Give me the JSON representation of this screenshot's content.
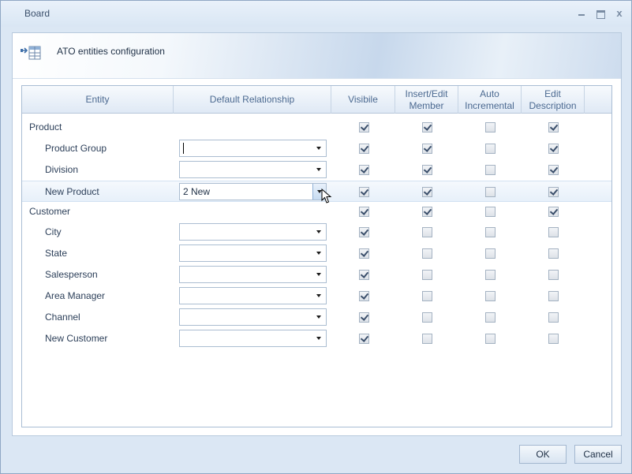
{
  "window": {
    "title": "Board",
    "controls": [
      "minimize-icon",
      "maximize-icon",
      "close-icon"
    ],
    "close_glyph": "x"
  },
  "banner": {
    "title": "ATO entities configuration",
    "icon": "table-link-icon"
  },
  "grid": {
    "columns": {
      "entity": "Entity",
      "default_relationship": "Default Relationship",
      "visible": "Visibile",
      "insert_edit_member": "Insert/Edit\nMember",
      "auto_incremental": "Auto\nIncremental",
      "edit_description": "Edit\nDescription"
    },
    "rows": [
      {
        "label": "Product",
        "level": 0,
        "combo": false,
        "visible": true,
        "insert_edit": true,
        "auto": false,
        "edit_desc": true
      },
      {
        "label": "Product Group",
        "level": 1,
        "combo": true,
        "value": "",
        "focused": true,
        "visible": true,
        "insert_edit": true,
        "auto": false,
        "edit_desc": true
      },
      {
        "label": "Division",
        "level": 1,
        "combo": true,
        "value": "",
        "visible": true,
        "insert_edit": true,
        "auto": false,
        "edit_desc": true
      },
      {
        "label": "New Product",
        "level": 1,
        "combo": true,
        "value": "2 New",
        "hover": true,
        "visible": true,
        "insert_edit": true,
        "auto": false,
        "edit_desc": true
      },
      {
        "label": "Customer",
        "level": 0,
        "combo": false,
        "visible": true,
        "insert_edit": true,
        "auto": false,
        "edit_desc": true
      },
      {
        "label": "City",
        "level": 1,
        "combo": true,
        "value": "",
        "visible": true,
        "insert_edit": false,
        "auto": false,
        "edit_desc": false
      },
      {
        "label": "State",
        "level": 1,
        "combo": true,
        "value": "",
        "visible": true,
        "insert_edit": false,
        "auto": false,
        "edit_desc": false
      },
      {
        "label": "Salesperson",
        "level": 1,
        "combo": true,
        "value": "",
        "visible": true,
        "insert_edit": false,
        "auto": false,
        "edit_desc": false
      },
      {
        "label": "Area Manager",
        "level": 1,
        "combo": true,
        "value": "",
        "visible": true,
        "insert_edit": false,
        "auto": false,
        "edit_desc": false
      },
      {
        "label": "Channel",
        "level": 1,
        "combo": true,
        "value": "",
        "visible": true,
        "insert_edit": false,
        "auto": false,
        "edit_desc": false
      },
      {
        "label": "New Customer",
        "level": 1,
        "combo": true,
        "value": "",
        "visible": true,
        "insert_edit": false,
        "auto": false,
        "edit_desc": false
      }
    ]
  },
  "buttons": {
    "ok": "OK",
    "cancel": "Cancel"
  },
  "colors": {
    "window_bg": "#dbe7f4",
    "header_text": "#4c6a91",
    "accent_hover": "#e7f0fa"
  }
}
